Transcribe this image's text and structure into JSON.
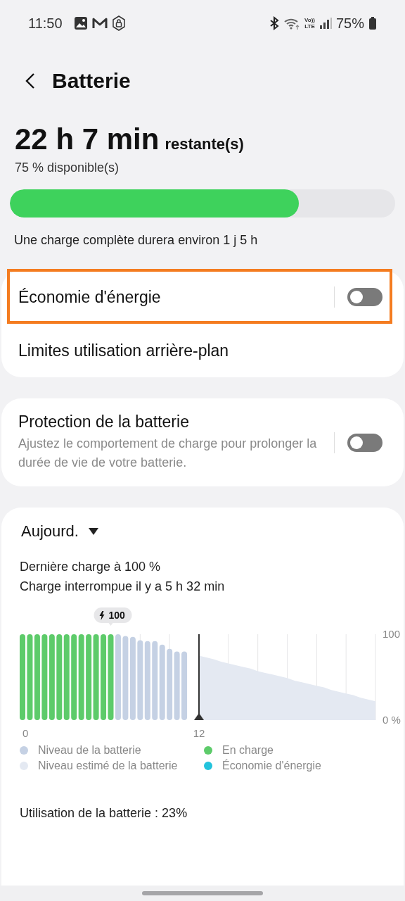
{
  "status_bar": {
    "time": "11:50",
    "volte": "Vo))",
    "lte": "LTE",
    "battery_text": "75%"
  },
  "header": {
    "title": "Batterie"
  },
  "summary": {
    "remaining": "22 h 7 min",
    "remaining_suffix": "restante(s)",
    "available": "75 % disponible(s)",
    "level": 0.75,
    "full_charge": "Une charge complète durera environ 1 j 5 h"
  },
  "settings_cards": [
    {
      "rows": [
        {
          "kind": "toggle",
          "label": "Économie d'énergie",
          "on": false,
          "highlighted": true
        },
        {
          "kind": "link",
          "label": "Limites utilisation arrière-plan"
        }
      ]
    },
    {
      "rows": [
        {
          "kind": "toggle",
          "label": "Protection de la batterie",
          "description": "Ajustez le comportement de charge pour prolonger la durée de vie de votre batterie.",
          "on": false
        }
      ]
    }
  ],
  "usage": {
    "period": "Aujourd.",
    "last_charge": "Dernière charge à 100 %",
    "charge_stopped": "Charge interrompue il y a 5 h 32 min",
    "chart_data": {
      "type": "bar",
      "x": [
        0,
        0.5,
        1,
        1.5,
        2,
        2.5,
        3,
        3.5,
        4,
        4.5,
        5,
        5.5,
        6,
        6.5,
        7,
        7.5,
        8,
        8.5,
        9,
        9.5,
        10,
        10.5,
        11,
        11.5,
        12,
        12.5,
        13,
        13.5,
        14,
        14.5,
        15,
        15.5,
        16,
        16.5,
        17,
        17.5,
        18,
        18.5,
        19,
        19.5,
        20,
        20.5,
        21,
        21.5,
        22,
        22.5,
        23,
        23.5,
        24
      ],
      "series": [
        {
          "name": "Niveau de la batterie",
          "color": "#c5d1e4",
          "values": [
            null,
            null,
            null,
            null,
            null,
            null,
            null,
            null,
            null,
            null,
            null,
            null,
            null,
            100,
            98,
            97,
            93,
            92,
            92,
            88,
            83,
            80,
            80,
            null,
            null,
            null,
            null,
            null,
            null,
            null,
            null,
            null,
            null,
            null,
            null,
            null,
            null,
            null,
            null,
            null,
            null,
            null,
            null,
            null,
            null,
            null,
            null,
            null,
            null
          ]
        },
        {
          "name": "En charge",
          "color": "#5dcb6a",
          "values": [
            100,
            100,
            100,
            100,
            100,
            100,
            100,
            100,
            100,
            100,
            100,
            100,
            100,
            null,
            null,
            null,
            null,
            null,
            null,
            null,
            null,
            null,
            null,
            null,
            null,
            null,
            null,
            null,
            null,
            null,
            null,
            null,
            null,
            null,
            null,
            null,
            null,
            null,
            null,
            null,
            null,
            null,
            null,
            null,
            null,
            null,
            null,
            null,
            null
          ]
        },
        {
          "name": "Niveau estimé de la batterie",
          "type": "area",
          "color": "#e4e9f2",
          "values": [
            null,
            null,
            null,
            null,
            null,
            null,
            null,
            null,
            null,
            null,
            null,
            null,
            null,
            null,
            null,
            null,
            null,
            null,
            null,
            null,
            null,
            null,
            null,
            null,
            75,
            73,
            71,
            68,
            66,
            64,
            62,
            60,
            57,
            55,
            53,
            51,
            49,
            46,
            44,
            42,
            40,
            38,
            35,
            33,
            31,
            29,
            26,
            24,
            22
          ]
        }
      ],
      "xlim": [
        0,
        24
      ],
      "ylim": [
        0,
        100
      ],
      "xticks": [
        0,
        12
      ],
      "yticks": [
        {
          "value": 0,
          "label": "0 %"
        },
        100
      ],
      "annotations": [
        {
          "x": 6,
          "y": 100,
          "text": "100"
        }
      ],
      "ref_lines": [
        {
          "axis": "x",
          "value": 12
        }
      ]
    },
    "legend_extra": [
      {
        "label": "Économie d'énergie",
        "color": "#22c3dc"
      }
    ],
    "usage_total": "Utilisation de la batterie : 23%"
  }
}
